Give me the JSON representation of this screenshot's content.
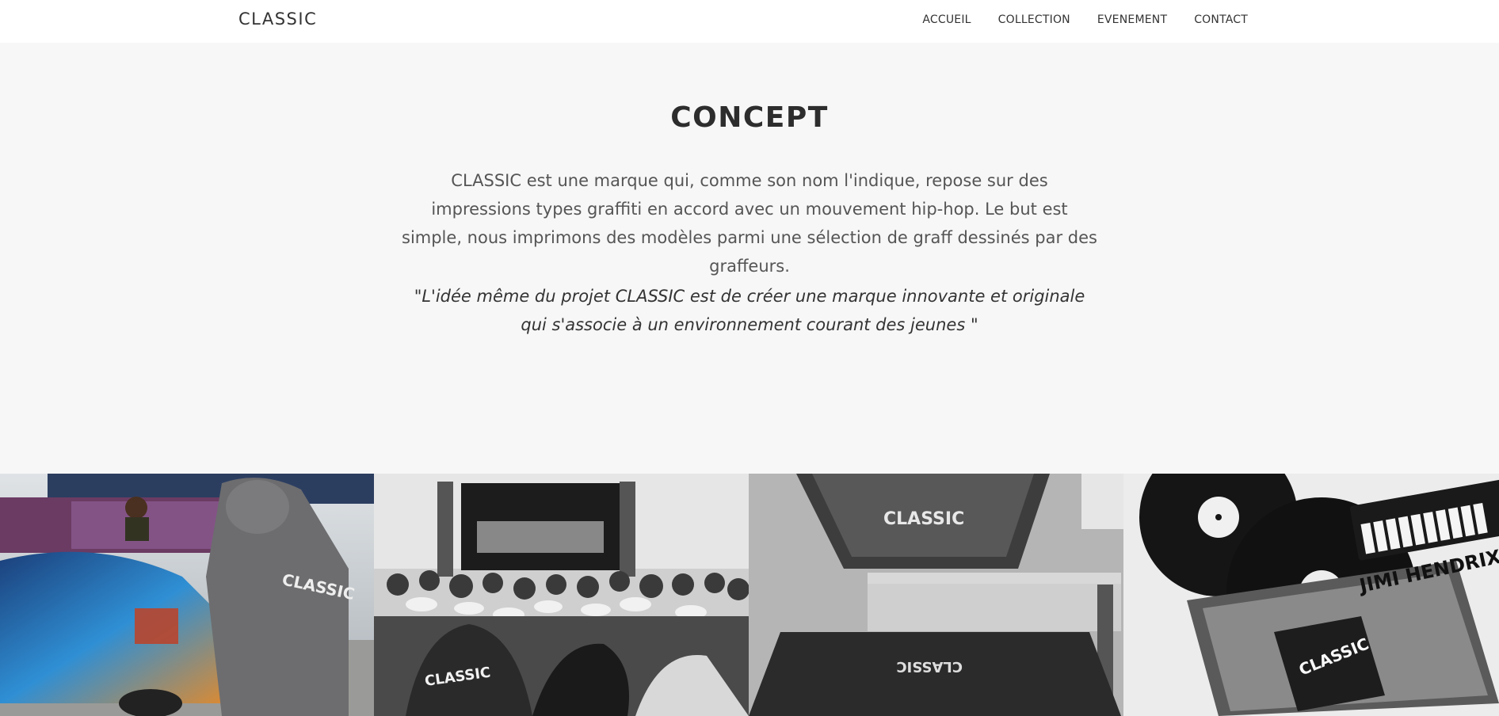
{
  "navbar": {
    "brand": "CLASSIC",
    "links": [
      {
        "label": "ACCUEIL"
      },
      {
        "label": "COLLECTION"
      },
      {
        "label": "EVENEMENT"
      },
      {
        "label": "CONTACT"
      }
    ]
  },
  "concept": {
    "title": "CONCEPT",
    "text": "CLASSIC est une marque qui, comme son nom l'indique, repose sur des impressions types graffiti en accord avec un mouvement hip-hop. Le but est simple, nous imprimons des modèles parmi une sélection de graff dessinés par des graffeurs.",
    "quote": "\"L'idée même du projet CLASSIC est de créer une marque innovante et originale qui s'associe à un environnement courant des jeunes \""
  },
  "gallery": {
    "images": [
      {
        "name": "graffiti-car-photo",
        "logo_text": "CLASSIC"
      },
      {
        "name": "concert-crowd-photo",
        "logo_text": "CLASSIC"
      },
      {
        "name": "screen-printing-photo",
        "logo_text": "CLASSIC"
      },
      {
        "name": "vinyl-records-photo",
        "logo_text": "CLASSIC",
        "album_text": "JIMI HENDRIX"
      }
    ]
  },
  "colors": {
    "background": "#f7f7f7",
    "navbar": "#ffffff",
    "title": "#2d2d2d",
    "body_text": "#555555"
  }
}
